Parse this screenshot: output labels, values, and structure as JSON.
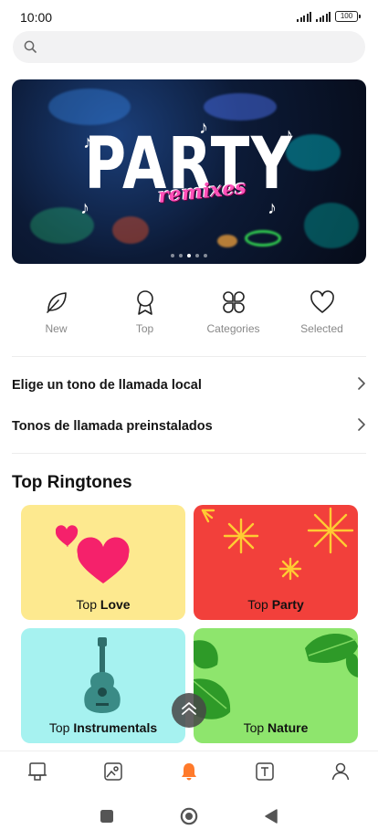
{
  "status_bar": {
    "time": "10:00",
    "battery": "100"
  },
  "search": {
    "placeholder": ""
  },
  "banner": {
    "title": "PARTY",
    "subtitle": "remixes",
    "slide_count": 5,
    "active_slide": 2
  },
  "categories": [
    {
      "label": "New",
      "icon": "leaf-icon"
    },
    {
      "label": "Top",
      "icon": "badge-icon"
    },
    {
      "label": "Categories",
      "icon": "grid-petals-icon"
    },
    {
      "label": "Selected",
      "icon": "heart-icon"
    }
  ],
  "links": [
    {
      "label": "Elige un tono de llamada local"
    },
    {
      "label": "Tonos de llamada preinstalados"
    }
  ],
  "section_title": "Top Ringtones",
  "tiles": [
    {
      "prefix": "Top ",
      "name": "Love",
      "bg": "#fde98f"
    },
    {
      "prefix": "Top ",
      "name": "Party",
      "bg": "#f2403b"
    },
    {
      "prefix": "Top ",
      "name": "Instrumentals",
      "bg": "#a6f2f0"
    },
    {
      "prefix": "Top ",
      "name": "Nature",
      "bg": "#8ee56d"
    }
  ],
  "nav": [
    {
      "icon": "kiosk-icon"
    },
    {
      "icon": "image-icon"
    },
    {
      "icon": "bell-icon",
      "active": true
    },
    {
      "icon": "text-icon"
    },
    {
      "icon": "profile-icon"
    }
  ],
  "colors": {
    "accent": "#ff7a2b",
    "muted": "#888888"
  }
}
